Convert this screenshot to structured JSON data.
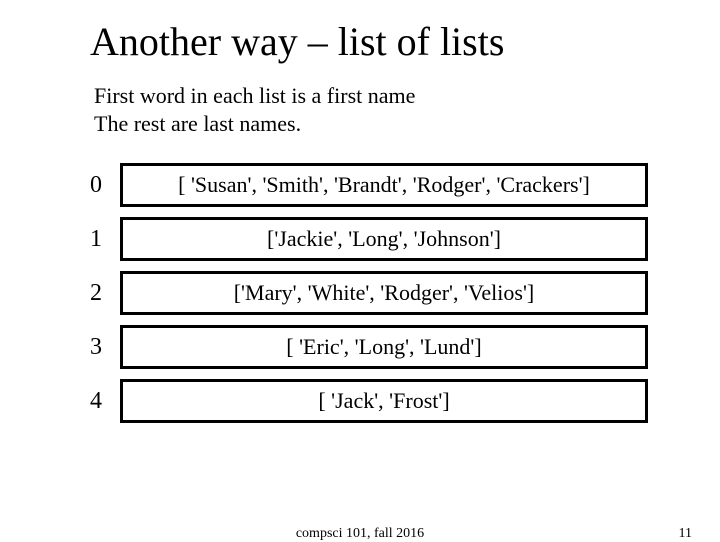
{
  "title": "Another way – list of lists",
  "subtitle_line1": "First word in each list is a first name",
  "subtitle_line2": "The rest are last names.",
  "rows": [
    {
      "index": "0",
      "content": "[ 'Susan', 'Smith', 'Brandt', 'Rodger', 'Crackers']"
    },
    {
      "index": "1",
      "content": "['Jackie', 'Long', 'Johnson']"
    },
    {
      "index": "2",
      "content": "['Mary', 'White', 'Rodger', 'Velios']"
    },
    {
      "index": "3",
      "content": "[ 'Eric', 'Long', 'Lund']"
    },
    {
      "index": "4",
      "content": "[ 'Jack', 'Frost']"
    }
  ],
  "footer_center": "compsci 101, fall 2016",
  "footer_page": "11"
}
